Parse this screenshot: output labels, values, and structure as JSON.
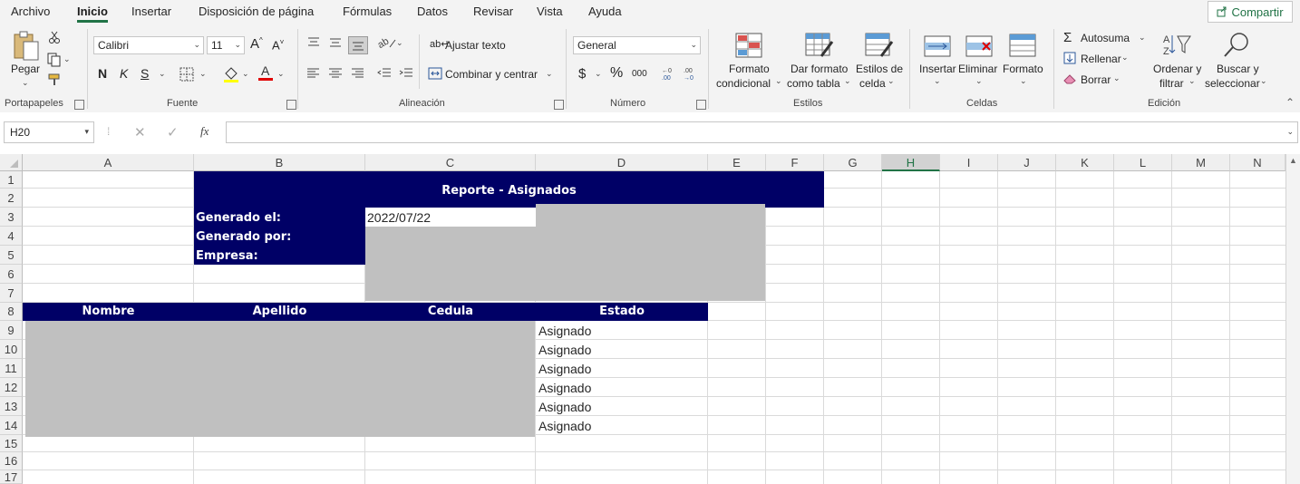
{
  "menu": {
    "items": [
      "Archivo",
      "Inicio",
      "Insertar",
      "Disposición de página",
      "Fórmulas",
      "Datos",
      "Revisar",
      "Vista",
      "Ayuda"
    ],
    "active_index": 1,
    "share_label": "Compartir"
  },
  "ribbon": {
    "portapapeles": {
      "paste_label": "Pegar",
      "group_label": "Portapapeles"
    },
    "fuente": {
      "font_name": "Calibri",
      "font_size": "11",
      "bold": "N",
      "italic": "K",
      "underline": "S",
      "group_label": "Fuente"
    },
    "alineacion": {
      "wrap_label": "Ajustar texto",
      "merge_label": "Combinar y centrar",
      "group_label": "Alineación"
    },
    "numero": {
      "format_value": "General",
      "currency": "$",
      "percent": "%",
      "thousands": "000",
      "group_label": "Número"
    },
    "estilos": {
      "cond_format_1": "Formato",
      "cond_format_2": "condicional",
      "table_format_1": "Dar formato",
      "table_format_2": "como tabla",
      "cell_styles_1": "Estilos de",
      "cell_styles_2": "celda",
      "group_label": "Estilos"
    },
    "celdas": {
      "insert": "Insertar",
      "delete": "Eliminar",
      "format": "Formato",
      "group_label": "Celdas"
    },
    "edicion": {
      "autosum": "Autosuma",
      "fill": "Rellenar",
      "clear": "Borrar",
      "sort_1": "Ordenar y",
      "sort_2": "filtrar",
      "find_1": "Buscar y",
      "find_2": "seleccionar",
      "group_label": "Edición"
    }
  },
  "formula_bar": {
    "name_box": "H20",
    "formula": "",
    "fx": "fx"
  },
  "grid": {
    "columns": [
      "A",
      "B",
      "C",
      "D",
      "E",
      "F",
      "G",
      "H",
      "I",
      "J",
      "K",
      "L",
      "M",
      "N"
    ],
    "selected_column": "H",
    "rows": [
      "1",
      "2",
      "3",
      "4",
      "5",
      "6",
      "7",
      "8",
      "9",
      "10",
      "11",
      "12",
      "13",
      "14",
      "15",
      "16",
      "17"
    ],
    "report_title": "Reporte -  Asignados",
    "generated_on_label": "Generado el:",
    "generated_on_value": "2022/07/22",
    "generated_by_label": "Generado por:",
    "company_label": "Empresa:",
    "table_headers": [
      "Nombre",
      "Apellido",
      "Cedula",
      "Estado"
    ],
    "estado_values": [
      "Asignado",
      "Asignado",
      "Asignado",
      "Asignado",
      "Asignado",
      "Asignado"
    ],
    "colors": {
      "header_navy": "#000066",
      "redacted_gray": "#c0c0c0",
      "excel_green": "#217346"
    }
  }
}
